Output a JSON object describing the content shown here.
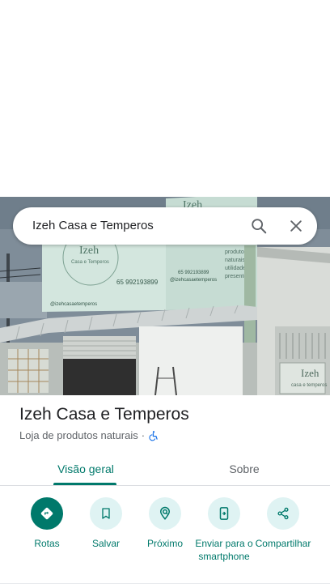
{
  "search": {
    "query": "Izeh Casa e Temperos"
  },
  "photo": {
    "sign_name": "Izeh",
    "sign_subtitle": "Casa e Temperos",
    "sign_phone": "65 992193899",
    "sign_instagram": "@izehcasaetemperos",
    "sign_products": [
      "produtos",
      "naturais",
      "utilidades",
      "presentes"
    ],
    "side_sign_name": "Izeh",
    "side_sign_subtitle": "casa e temperos",
    "left_handle": "@izehcasaetemperos"
  },
  "place": {
    "name": "Izeh Casa e Temperos",
    "category": "Loja de produtos naturais",
    "separator": "·"
  },
  "tabs": [
    {
      "label": "Visão geral",
      "active": true
    },
    {
      "label": "Sobre",
      "active": false
    }
  ],
  "actions": [
    {
      "label": "Rotas",
      "icon": "directions-icon"
    },
    {
      "label": "Salvar",
      "icon": "bookmark-icon"
    },
    {
      "label": "Próximo",
      "icon": "nearby-icon"
    },
    {
      "label": "Enviar para o smartphone",
      "icon": "send-to-phone-icon"
    },
    {
      "label": "Compartilhar",
      "icon": "share-icon"
    }
  ],
  "colors": {
    "accent": "#00796b",
    "accent_light": "#dff3f3",
    "text_primary": "#202124",
    "text_secondary": "#5f6368",
    "accessibility": "#1a73e8"
  }
}
